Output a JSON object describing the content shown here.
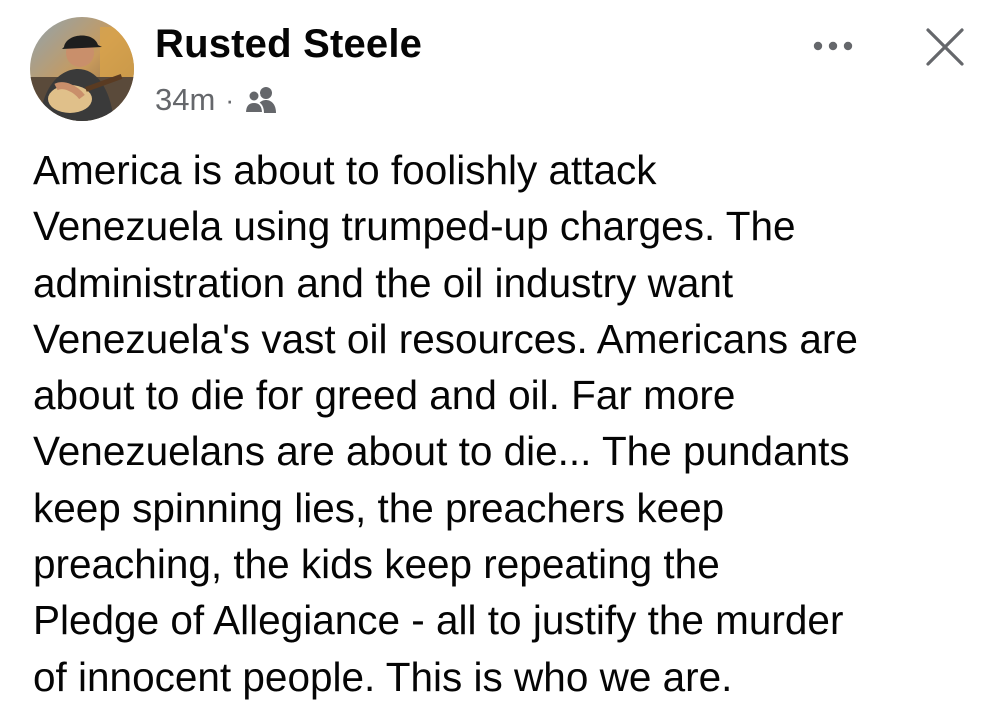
{
  "post": {
    "author": {
      "name": "Rusted Steele",
      "avatar_icon": "profile-photo-guitar-player"
    },
    "timestamp": "34m",
    "separator": "·",
    "audience_icon": "friends-icon",
    "more_icon": "more-options-icon",
    "close_icon": "close-icon",
    "text_lines": [
      "America is about to foolishly attack",
      "Venezuela using trumped-up charges. The",
      "administration and the oil industry want",
      "Venezuela's vast oil resources. Americans are",
      "about to die for greed and oil. Far more",
      "Venezuelans are about to die... The pundants",
      "keep spinning lies, the preachers keep",
      "preaching, the kids keep repeating the",
      "Pledge of Allegiance - all to justify the murder",
      "of innocent people. This is who we are."
    ]
  },
  "colors": {
    "text_primary": "#050505",
    "text_secondary": "#65676b",
    "background": "#ffffff"
  }
}
